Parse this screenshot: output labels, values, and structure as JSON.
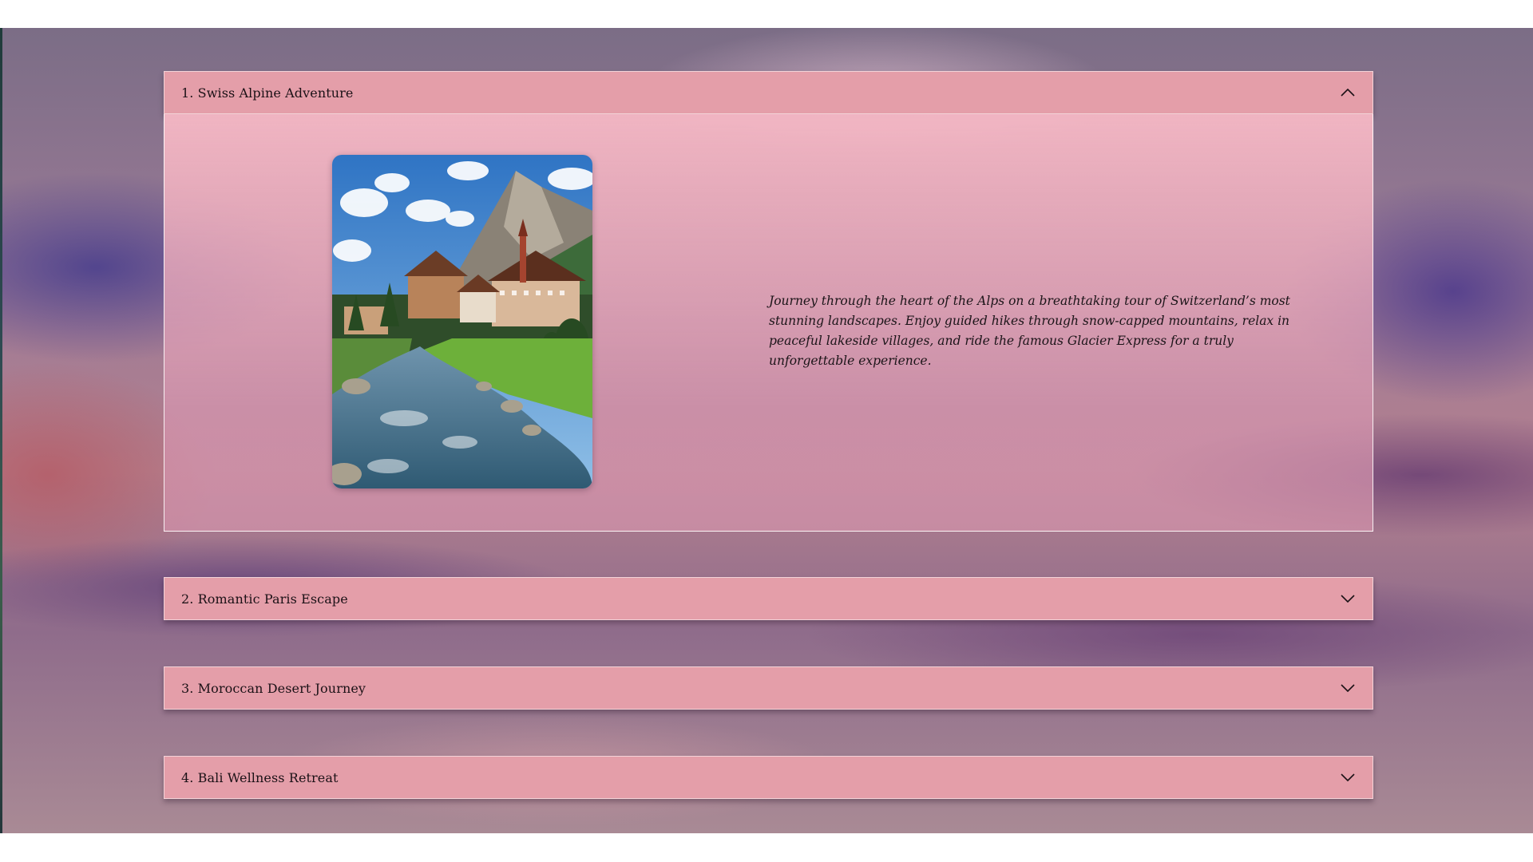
{
  "accordion": {
    "items": [
      {
        "title": "1. Swiss Alpine Adventure",
        "expanded": true,
        "chevron_icon": "chevron-up-icon",
        "description": "Journey through the heart of the Alps on a breathtaking tour of Switzerland’s most stunning landscapes. Enjoy guided hikes through snow-capped mountains, relax in peaceful lakeside villages, and ride the famous Glacier Express for a truly unforgettable experience."
      },
      {
        "title": "2. Romantic Paris Escape",
        "expanded": false,
        "chevron_icon": "chevron-down-icon"
      },
      {
        "title": "3. Moroccan Desert Journey",
        "expanded": false,
        "chevron_icon": "chevron-down-icon"
      },
      {
        "title": "4. Bali Wellness Retreat",
        "expanded": false,
        "chevron_icon": "chevron-down-icon"
      }
    ]
  },
  "colors": {
    "header_bg": "#e49ea9",
    "body_bg": "#f1b5c3",
    "text": "#1b1116"
  }
}
